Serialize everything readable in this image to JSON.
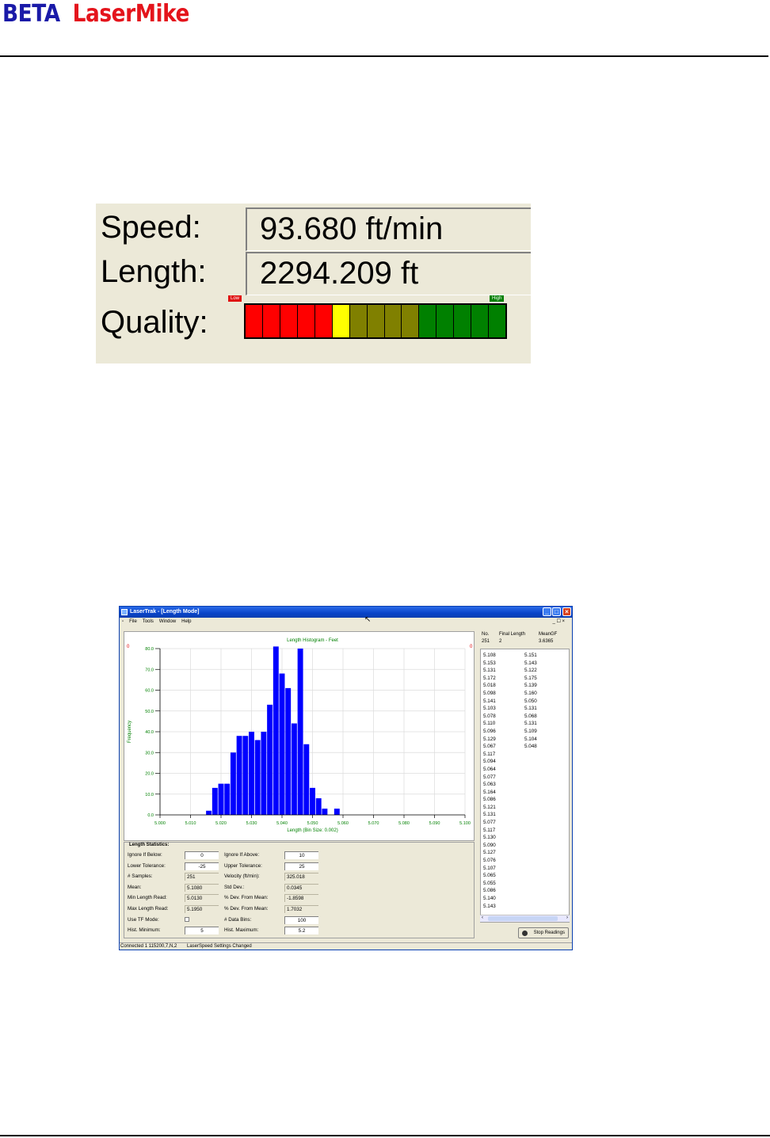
{
  "header": {
    "beta": "BETA",
    "brand": "LaserMike"
  },
  "readout": {
    "speed_label": "Speed:",
    "speed_value": "93.680 ft/min",
    "length_label": "Length:",
    "length_value": "2294.209 ft",
    "quality_label": "Quality:",
    "quality_low": "Low",
    "quality_high": "High",
    "quality_segments": [
      "#ff0000",
      "#ff0000",
      "#ff0000",
      "#ff0000",
      "#ff0000",
      "#ffff00",
      "#808000",
      "#808000",
      "#808000",
      "#808000",
      "#008000",
      "#008000",
      "#008000",
      "#008000",
      "#008000"
    ]
  },
  "window": {
    "title": "LaserTrak - [Length Mode]",
    "menu": [
      "File",
      "Tools",
      "Window",
      "Help"
    ],
    "mdi_controls": "_ ☐ ×",
    "chart_title": "Length Histogram - Feet",
    "marker_left": "0",
    "marker_right": "0",
    "stats_title": "Length Statistics:",
    "stats_left": [
      {
        "label": "Ignore If Below:",
        "value": "0",
        "kind": "in"
      },
      {
        "label": "Lower Tolerance:",
        "value": "-25",
        "kind": "in"
      },
      {
        "label": "# Samples:",
        "value": "251",
        "kind": "ro"
      },
      {
        "label": "Mean:",
        "value": "5.1080",
        "kind": "ro"
      },
      {
        "label": "Min Length Read:",
        "value": "5.0130",
        "kind": "ro"
      },
      {
        "label": "Max Length Read:",
        "value": "5.1950",
        "kind": "ro"
      },
      {
        "label": "Use TF Mode:",
        "value": "",
        "kind": "chk"
      },
      {
        "label": "Hist. Minimum:",
        "value": "5",
        "kind": "in"
      }
    ],
    "stats_right": [
      {
        "label": "Ignore If Above:",
        "value": "10",
        "kind": "in"
      },
      {
        "label": "Upper Tolerance:",
        "value": "25",
        "kind": "in"
      },
      {
        "label": "Velocity (ft/min):",
        "value": "325.018",
        "kind": "ro"
      },
      {
        "label": "Std Dev.:",
        "value": "0.0345",
        "kind": "ro"
      },
      {
        "label": "% Dev. From Mean:",
        "value": "-1.8598",
        "kind": "ro"
      },
      {
        "label": "% Dev. From Mean:",
        "value": "1.7032",
        "kind": "ro"
      },
      {
        "label": "# Data Bins:",
        "value": "100",
        "kind": "in"
      },
      {
        "label": "Hist. Maximum:",
        "value": "5.2",
        "kind": "in"
      }
    ],
    "list_headers": {
      "no": "No.",
      "final": "Final Length",
      "mean": "MeanGF"
    },
    "list_summary": {
      "no": "251",
      "final": "2",
      "mean": "3.6365"
    },
    "readings_col1": [
      "5.108",
      "5.153",
      "5.131",
      "5.172",
      "5.018",
      "5.098",
      "5.141",
      "5.103",
      "5.078",
      "5.110",
      "5.096",
      "5.129",
      "5.067",
      "5.117",
      "5.094",
      "5.064",
      "5.077",
      "5.063",
      "5.164",
      "5.086",
      "5.121",
      "5.131",
      "5.077",
      "5.117",
      "5.130",
      "5.090",
      "5.127",
      "5.076",
      "5.107",
      "5.065",
      "5.055",
      "5.086",
      "5.140",
      "5.143"
    ],
    "readings_col2": [
      "5.151",
      "5.143",
      "5.122",
      "5.175",
      "5.139",
      "5.160",
      "5.050",
      "5.131",
      "5.068",
      "5.131",
      "5.109",
      "5.104",
      "5.048"
    ],
    "stop_button": "Stop Readings",
    "status_left": "Connected 1 115200,7,N,2",
    "status_right": "LaserSpeed Settings Changed"
  },
  "chart_data": {
    "type": "bar",
    "title": "Length Histogram - Feet",
    "xlabel": "Length (Bin Size: 0.002)",
    "ylabel": "Frequency",
    "xlim": [
      5.0,
      5.1
    ],
    "ylim": [
      0,
      80
    ],
    "x_ticks": [
      "5.000",
      "5.010",
      "5.020",
      "5.030",
      "5.040",
      "5.050",
      "5.060",
      "5.070",
      "5.080",
      "5.090",
      "5.100"
    ],
    "y_ticks": [
      "0.0",
      "10.0",
      "20.0",
      "30.0",
      "40.0",
      "50.0",
      "60.0",
      "70.0",
      "80.0"
    ],
    "grid": true,
    "bar_color": "#0000ff",
    "x": [
      5.016,
      5.018,
      5.02,
      5.022,
      5.024,
      5.026,
      5.028,
      5.03,
      5.032,
      5.034,
      5.036,
      5.038,
      5.04,
      5.042,
      5.044,
      5.046,
      5.048,
      5.05,
      5.052,
      5.054,
      5.056,
      5.058,
      5.06,
      5.062,
      5.064,
      5.066,
      5.068,
      5.07,
      5.072,
      5.074,
      5.076,
      5.078
    ],
    "values": [
      2,
      13,
      15,
      15,
      30,
      38,
      38,
      40,
      36,
      40,
      53,
      81,
      68,
      61,
      44,
      80,
      34,
      13,
      8,
      3,
      0,
      3,
      0,
      0,
      0,
      0,
      0,
      0,
      0,
      0,
      0,
      0
    ]
  }
}
